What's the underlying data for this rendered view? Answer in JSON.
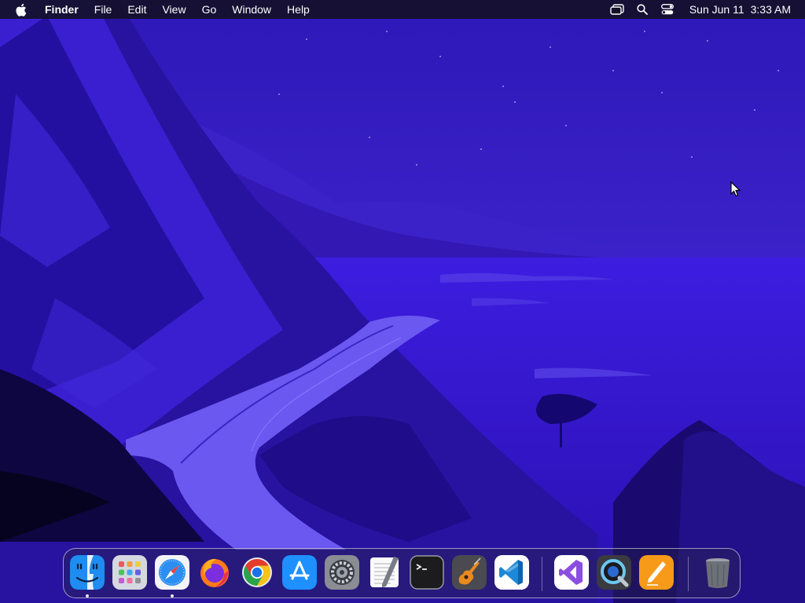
{
  "menubar": {
    "app_name": "Finder",
    "items": [
      "File",
      "Edit",
      "View",
      "Go",
      "Window",
      "Help"
    ],
    "clock_date": "Sun Jun 11",
    "clock_time": "3:33 AM",
    "status_icons": [
      "stage-manager-icon",
      "spotlight-search-icon",
      "control-center-icon"
    ]
  },
  "dock": {
    "apps": [
      {
        "name": "finder-icon",
        "running": true
      },
      {
        "name": "launchpad-icon",
        "running": false
      },
      {
        "name": "safari-icon",
        "running": true
      },
      {
        "name": "firefox-icon",
        "running": false
      },
      {
        "name": "chrome-icon",
        "running": false
      },
      {
        "name": "app-store-icon",
        "running": false
      },
      {
        "name": "system-settings-icon",
        "running": false
      },
      {
        "name": "textedit-icon",
        "running": false
      },
      {
        "name": "terminal-icon",
        "running": false
      },
      {
        "name": "garageband-icon",
        "running": false
      },
      {
        "name": "vscode-icon",
        "running": false
      },
      {
        "name": "visual-studio-icon",
        "running": false
      },
      {
        "name": "quicktime-icon",
        "running": false
      },
      {
        "name": "pages-icon",
        "running": false
      },
      {
        "name": "trash-icon",
        "running": false
      }
    ]
  },
  "colors": {
    "sky": "#3a1fd0",
    "sea": "#3614c8",
    "cliffs": "#2a11a8",
    "road": "#6a58f0",
    "menubar_bg": "#141028"
  }
}
